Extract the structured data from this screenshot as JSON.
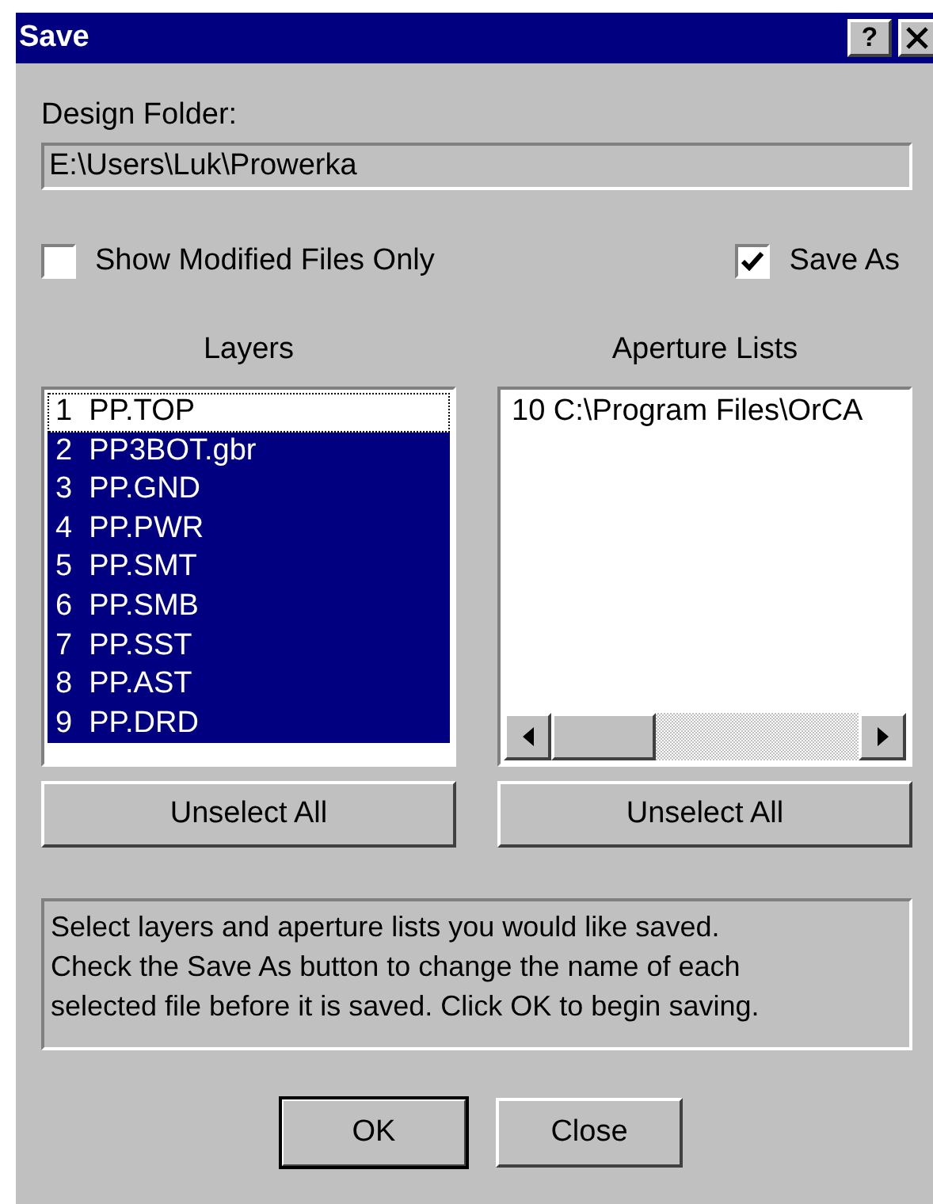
{
  "window": {
    "title": "Save",
    "help_button": "?"
  },
  "design_folder": {
    "label": "Design Folder:",
    "value": "E:\\Users\\Luk\\Prowerka"
  },
  "options": [
    {
      "label": "Show Modified Files Only",
      "checked": false
    },
    {
      "label": "Save As",
      "checked": true
    }
  ],
  "layers": {
    "heading": "Layers",
    "items": [
      {
        "label": "1  PP.TOP",
        "selected": false,
        "focused": true
      },
      {
        "label": "2  PP3BOT.gbr",
        "selected": true,
        "focused": false
      },
      {
        "label": "3  PP.GND",
        "selected": true,
        "focused": false
      },
      {
        "label": "4  PP.PWR",
        "selected": true,
        "focused": false
      },
      {
        "label": "5  PP.SMT",
        "selected": true,
        "focused": false
      },
      {
        "label": "6  PP.SMB",
        "selected": true,
        "focused": false
      },
      {
        "label": "7  PP.SST",
        "selected": true,
        "focused": false
      },
      {
        "label": "8  PP.AST",
        "selected": true,
        "focused": false
      },
      {
        "label": "9  PP.DRD",
        "selected": true,
        "focused": false
      }
    ],
    "button": "Unselect All"
  },
  "aperture_lists": {
    "heading": "Aperture Lists",
    "items": [
      {
        "label": "10 C:\\Program Files\\OrCA",
        "selected": false,
        "focused": false
      }
    ],
    "button": "Unselect All"
  },
  "info": [
    "Select layers and aperture lists you would like saved.",
    "Check the Save As button to change the name of each",
    "selected file before it is saved. Click OK to begin saving."
  ],
  "buttons": [
    {
      "label": "OK",
      "default": true
    },
    {
      "label": "Close",
      "default": false
    }
  ]
}
